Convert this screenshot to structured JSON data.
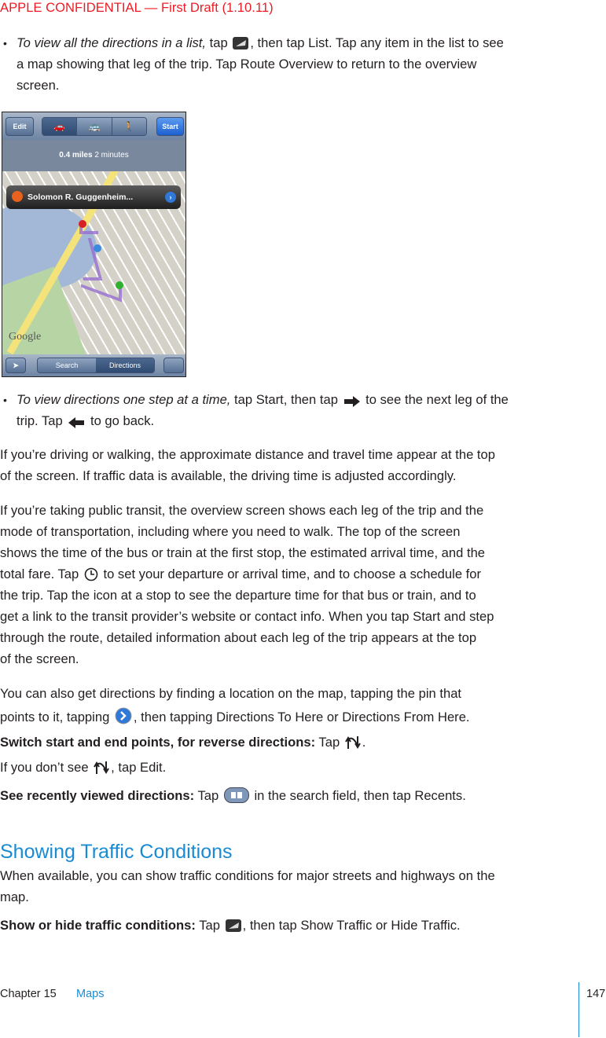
{
  "header": "APPLE CONFIDENTIAL — First Draft (1.10.11)",
  "bullet1": {
    "em": "To view all the directions in a list,",
    "l1a": " tap ",
    "l1b": ", then tap List. Tap any item in the list to see",
    "l2": "a map showing that leg of the trip. Tap Route Overview to return to the overview",
    "l3": "screen."
  },
  "screenshot": {
    "edit": "Edit",
    "start": "Start",
    "distance": "0.4 miles",
    "time": "2 minutes",
    "place": "Solomon R. Guggenheim...",
    "search": "Search",
    "directions": "Directions",
    "logo": "Google"
  },
  "bullet2": {
    "em": "To view directions one step at a time,",
    "l1a": " tap Start, then tap ",
    "l1b": " to see the next leg of the",
    "l2a": "trip. Tap ",
    "l2b": " to go back."
  },
  "p1": [
    "If you’re driving or walking, the approximate distance and travel time appear at the top",
    "of the screen. If traffic data is available, the driving time is adjusted accordingly."
  ],
  "p2": {
    "l1": "If you’re taking public transit, the overview screen shows each leg of the trip and the",
    "l2": "mode of transportation, including where you need to walk. The top of the screen",
    "l3": "shows the time of the bus or train at the first stop, the estimated arrival time, and the",
    "l4a": "total fare. Tap ",
    "l4b": " to set your departure or arrival time, and to choose a schedule for",
    "l5": "the trip. Tap the icon at a stop to see the departure time for that bus or train, and to",
    "l6": "get a link to the transit provider’s website or contact info. When you tap Start and step",
    "l7": "through the route, detailed information about each leg of the trip appears at the top",
    "l8": "of the screen."
  },
  "p3": {
    "l1": "You can also get directions by finding a location on the map, tapping the pin that",
    "l2a": "points to it, tapping ",
    "l2b": ", then tapping Directions To Here or Directions From Here."
  },
  "switch": {
    "title": "Switch start and end points, for reverse directions:",
    "a": "  Tap ",
    "b": "."
  },
  "p4": {
    "a": "If you don’t see ",
    "b": ", tap Edit."
  },
  "recent": {
    "title": "See recently viewed directions:",
    "a": "  Tap ",
    "b": " in the search field, then tap Recents."
  },
  "heading": "Showing Traffic Conditions",
  "p5": [
    "When available, you can show traffic conditions for major streets and highways on the",
    "map."
  ],
  "traffic": {
    "title": "Show or hide traffic conditions:",
    "a": "  Tap ",
    "b": ", then tap Show Traffic or Hide Traffic."
  },
  "footer": {
    "chapter": "Chapter 15",
    "section": "Maps",
    "page": "147"
  },
  "colors": {
    "header": "#ed1c24",
    "accent": "#1a8bd3"
  }
}
